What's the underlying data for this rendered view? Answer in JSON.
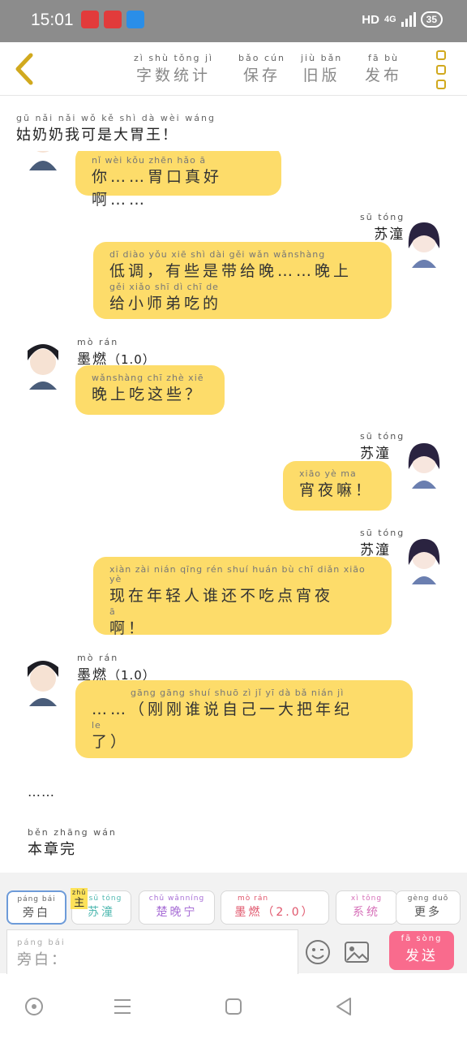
{
  "status_bar": {
    "time": "15:01",
    "network": "HD",
    "signal_label": "4G",
    "battery": "35"
  },
  "top_tabs": [
    {
      "label": "字数统计",
      "pinyin": "zì shù tǒng jì"
    },
    {
      "label": "保存",
      "pinyin": "bǎo cún"
    },
    {
      "label": "旧版",
      "pinyin": "jiù bǎn"
    },
    {
      "label": "发布",
      "pinyin": "fā bù"
    }
  ],
  "chat_title": {
    "text": "姑奶奶我可是大胃王！",
    "pinyin": "gū nǎi nǎi wǒ kě shì dà wèi wáng"
  },
  "messages": [
    {
      "text": "你……胃口真好啊……",
      "pinyin": "nǐ       wèi kǒu zhēn hǎo  ā"
    },
    {
      "sender": "苏潼",
      "sender_pinyin": "sū tóng",
      "text": "低调，有些是带给晚……晚上给小师弟吃的",
      "line1": "低调，有些是带给晚……晚上",
      "line1_pinyin": "dī diào    yǒu xiē shì dài gěi wǎn      wǎnshàng",
      "line2": "给小师弟吃的",
      "line2_pinyin": "gěi xiǎo shī  dì  chī  de"
    },
    {
      "sender": "墨燃",
      "sender_pinyin": "mò rán",
      "sender_suffix": "（1.0）",
      "text": "晚上吃这些？",
      "pinyin": "wǎnshàng chī zhè xiē"
    },
    {
      "sender": "苏潼",
      "sender_pinyin": "sū tóng",
      "text": "宵夜嘛！",
      "pinyin": "xiāo yè  ma"
    },
    {
      "sender": "苏潼",
      "sender_pinyin": "sū tóng",
      "line1": "现在年轻人谁还不吃点宵夜",
      "line1_pinyin": "xiàn zài nián qīng rén shuí huán bù  chī diǎn xiāo  yè",
      "line2": "啊！",
      "line2_pinyin": "ā"
    },
    {
      "sender": "墨燃",
      "sender_pinyin": "mò rán",
      "sender_suffix": "（1.0）",
      "line1": "……（刚刚谁说自己一大把年纪",
      "line1_pinyin": "gāng gāng shuí shuō  zì   jǐ   yī   dà   bǎ  nián  jì",
      "line2": "了）",
      "line2_pinyin": "le"
    }
  ],
  "narration_dots": "……",
  "chapter_end": {
    "text": "本章完",
    "pinyin": "běn zhāng wán"
  },
  "role_chips": [
    {
      "label": "旁白",
      "pinyin": "páng bái",
      "color": "#555555"
    },
    {
      "label": "苏潼",
      "pinyin": "sū tóng",
      "color": "#4fb8b0",
      "tag": "主",
      "tag_pinyin": "zhǔ"
    },
    {
      "label": "楚晚宁",
      "pinyin": "chǔ wǎnníng",
      "color": "#a86fd6"
    },
    {
      "label": "墨燃（2.0）",
      "pinyin": "mò rán",
      "color": "#e0556b"
    },
    {
      "label": "系统",
      "pinyin": "xì tǒng",
      "color": "#d66fb8"
    },
    {
      "label": "更多",
      "pinyin": "gèng duō",
      "color": "#555555"
    }
  ],
  "input": {
    "label": "旁白：",
    "pinyin": "páng bái"
  },
  "send_button": {
    "label": "发送",
    "pinyin": "fā sòng"
  },
  "colors": {
    "bubble": "#fddc6a",
    "send": "#f96b8d",
    "accent": "#d1a91e"
  }
}
